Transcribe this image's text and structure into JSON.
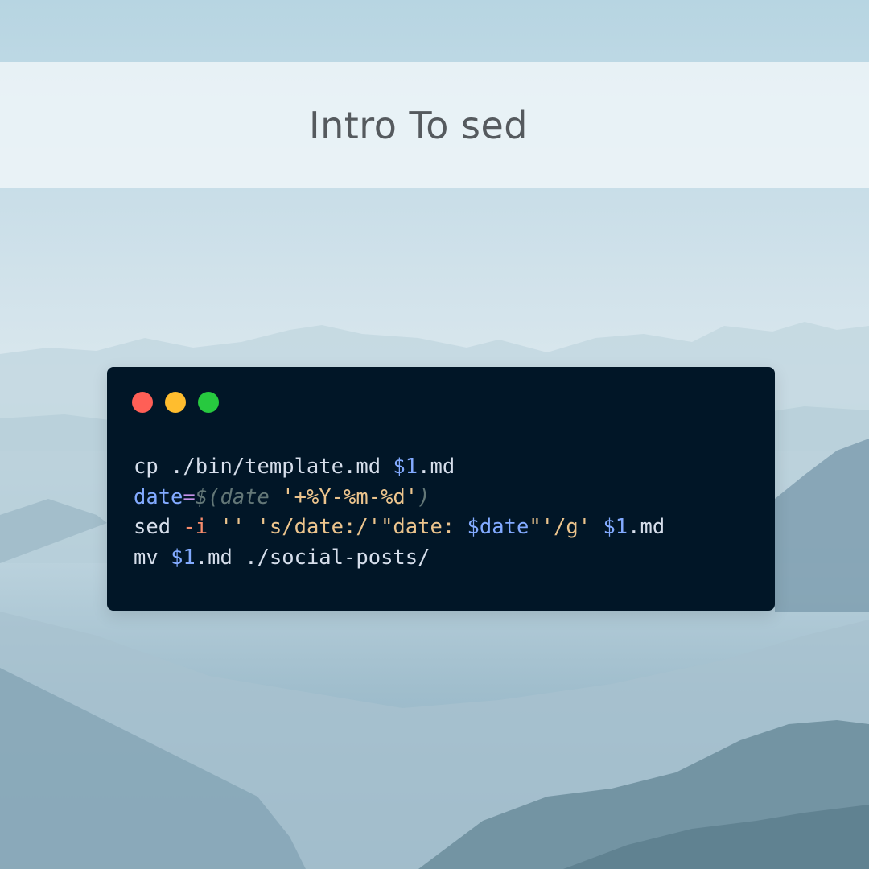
{
  "header": {
    "title": "Intro To sed"
  },
  "window": {
    "dots": [
      {
        "name": "close",
        "color": "#ff5f56"
      },
      {
        "name": "minimize",
        "color": "#ffbd2e"
      },
      {
        "name": "maximize",
        "color": "#27c93f"
      }
    ]
  },
  "code": {
    "lines": [
      [
        {
          "t": "cp ./bin/template.md ",
          "c": "plain"
        },
        {
          "t": "$1",
          "c": "var"
        },
        {
          "t": ".md",
          "c": "plain"
        }
      ],
      [
        {
          "t": "date",
          "c": "var"
        },
        {
          "t": "=",
          "c": "op"
        },
        {
          "t": "$(date ",
          "c": "sub"
        },
        {
          "t": "'+%Y-%m-%d'",
          "c": "str"
        },
        {
          "t": ")",
          "c": "sub"
        }
      ],
      [
        {
          "t": "sed ",
          "c": "plain"
        },
        {
          "t": "-i",
          "c": "flag"
        },
        {
          "t": " ",
          "c": "plain"
        },
        {
          "t": "'' 's/date:/'\"date: ",
          "c": "str"
        },
        {
          "t": "$date",
          "c": "var"
        },
        {
          "t": "\"'/g'",
          "c": "str"
        },
        {
          "t": " ",
          "c": "plain"
        },
        {
          "t": "$1",
          "c": "var"
        },
        {
          "t": ".md",
          "c": "plain"
        }
      ],
      [
        {
          "t": "mv ",
          "c": "plain"
        },
        {
          "t": "$1",
          "c": "var"
        },
        {
          "t": ".md ./social-posts/",
          "c": "plain"
        }
      ]
    ]
  }
}
